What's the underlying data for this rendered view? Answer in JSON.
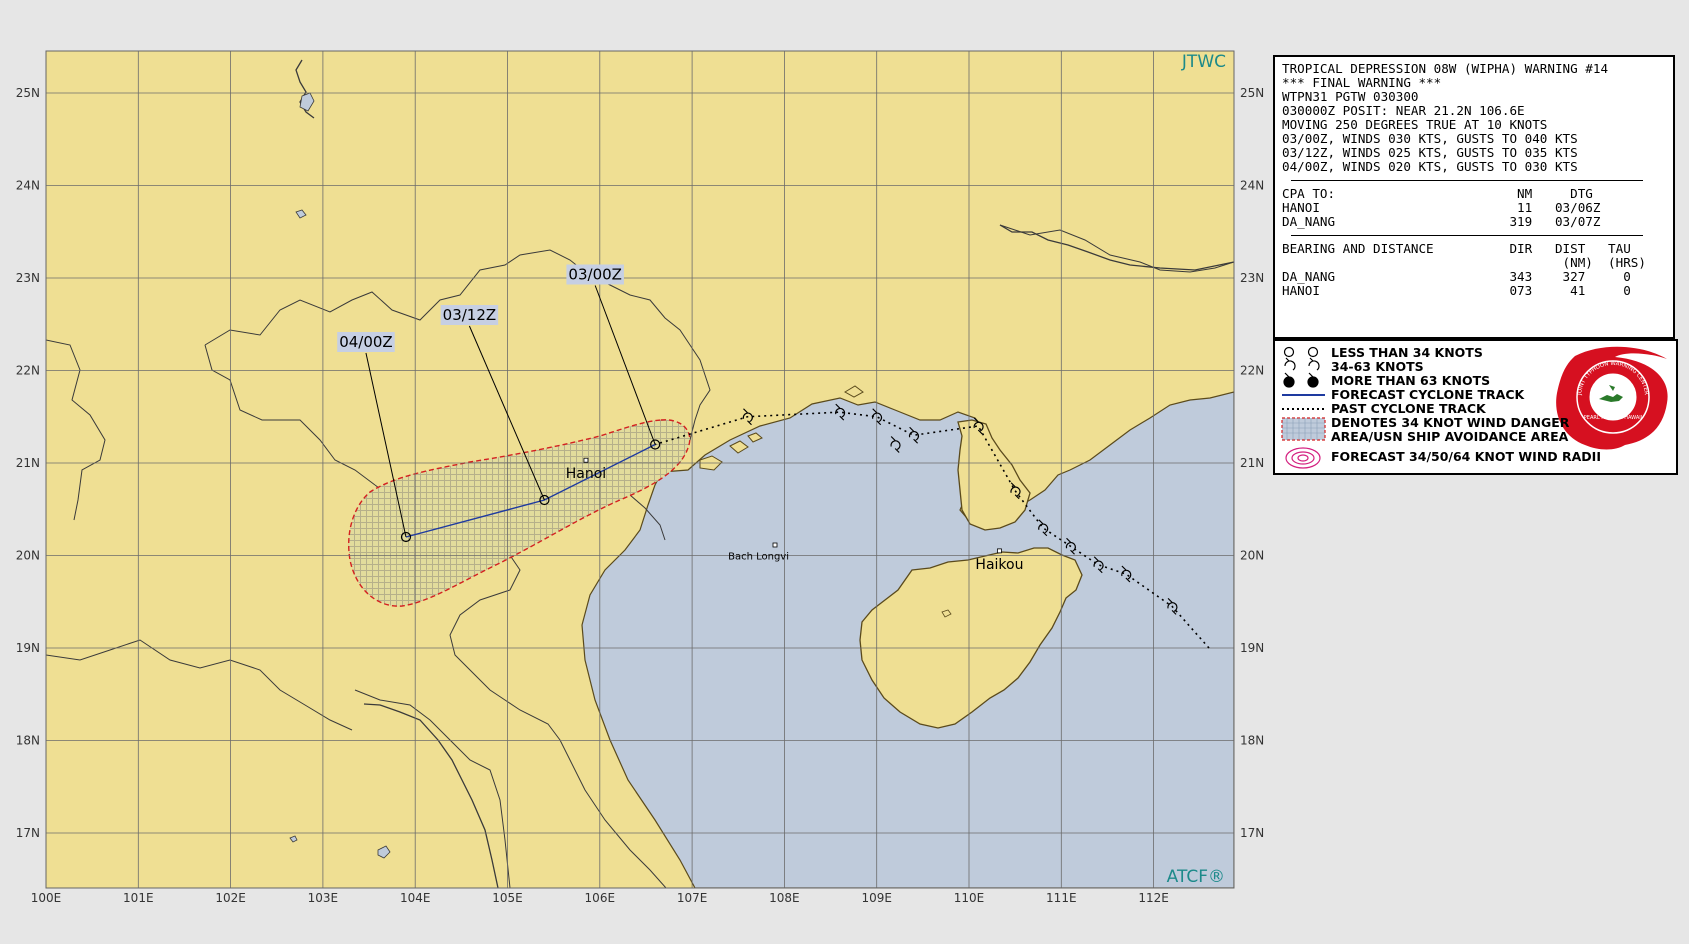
{
  "map": {
    "agency_label": "JTWC",
    "system_label": "ATCF®",
    "colors": {
      "land": "#efdf93",
      "sea": "#bfcbdb",
      "background": "#e6e6e6",
      "grid": "#6b6b6b",
      "track": "#1e3aa0",
      "danger_area": "#d0d0d0",
      "danger_edge": "#d42020"
    },
    "lon_labels": [
      "100E",
      "101E",
      "102E",
      "103E",
      "104E",
      "105E",
      "106E",
      "107E",
      "108E",
      "109E",
      "110E",
      "111E",
      "112E"
    ],
    "lat_labels": [
      "25N",
      "24N",
      "23N",
      "22N",
      "21N",
      "20N",
      "19N",
      "18N",
      "17N"
    ],
    "cities": [
      {
        "name": "Hanoi",
        "lon": 105.85,
        "lat": 21.03
      },
      {
        "name": "Bach Longvi",
        "lon": 107.72,
        "lat": 20.13
      },
      {
        "name": "Haikou",
        "lon": 110.33,
        "lat": 20.05
      }
    ],
    "forecast_points": [
      {
        "label": "03/00Z",
        "lon": 106.6,
        "lat": 21.2
      },
      {
        "label": "03/12Z",
        "lon": 105.4,
        "lat": 20.6
      },
      {
        "label": "04/00Z",
        "lon": 103.9,
        "lat": 20.2
      }
    ],
    "past_track": [
      {
        "lon": 112.6,
        "lat": 19.0
      },
      {
        "lon": 112.2,
        "lat": 19.45
      },
      {
        "lon": 111.7,
        "lat": 19.8
      },
      {
        "lon": 111.4,
        "lat": 19.9
      },
      {
        "lon": 111.1,
        "lat": 20.1
      },
      {
        "lon": 110.8,
        "lat": 20.3
      },
      {
        "lon": 110.5,
        "lat": 20.7
      },
      {
        "lon": 110.1,
        "lat": 21.4
      },
      {
        "lon": 109.4,
        "lat": 21.3
      },
      {
        "lon": 109.0,
        "lat": 21.5
      },
      {
        "lon": 108.6,
        "lat": 21.55
      },
      {
        "lon": 107.6,
        "lat": 21.5
      },
      {
        "lon": 106.6,
        "lat": 21.2
      }
    ],
    "past_track_symbols": [
      {
        "lon": 112.2,
        "lat": 19.45
      },
      {
        "lon": 111.4,
        "lat": 19.9
      },
      {
        "lon": 111.7,
        "lat": 19.8
      },
      {
        "lon": 111.1,
        "lat": 20.1
      },
      {
        "lon": 110.8,
        "lat": 20.3
      },
      {
        "lon": 110.5,
        "lat": 20.7
      },
      {
        "lon": 110.1,
        "lat": 21.4
      },
      {
        "lon": 109.4,
        "lat": 21.3
      },
      {
        "lon": 109.2,
        "lat": 21.2
      },
      {
        "lon": 109.0,
        "lat": 21.5
      },
      {
        "lon": 108.6,
        "lat": 21.55
      },
      {
        "lon": 107.6,
        "lat": 21.5
      }
    ]
  },
  "warning": {
    "lines": [
      "TROPICAL DEPRESSION 08W (WIPHA) WARNING #14",
      "*** FINAL WARNING ***",
      "WTPN31 PGTW 030300",
      "030000Z POSIT: NEAR 21.2N 106.6E",
      "MOVING 250 DEGREES TRUE AT 10 KNOTS",
      "03/00Z, WINDS 030 KTS, GUSTS TO 040 KTS",
      "03/12Z, WINDS 025 KTS, GUSTS TO 035 KTS",
      "04/00Z, WINDS 020 KTS, GUSTS TO 030 KTS"
    ],
    "cpa_lines": [
      "CPA TO:                        NM     DTG",
      "HANOI                          11   03/06Z",
      "DA_NANG                       319   03/07Z"
    ],
    "bearing_lines": [
      "BEARING AND DISTANCE          DIR   DIST   TAU",
      "                                     (NM)  (HRS)",
      "DA_NANG                       343    327     0",
      "HANOI                         073     41     0"
    ]
  },
  "legend": {
    "items": [
      "LESS THAN 34 KNOTS",
      "34-63 KNOTS",
      "MORE THAN 63 KNOTS",
      "FORECAST CYCLONE TRACK",
      "PAST CYCLONE TRACK",
      "DENOTES 34 KNOT WIND DANGER",
      "AREA/USN SHIP AVOIDANCE AREA",
      "FORECAST 34/50/64 KNOT WIND RADII"
    ],
    "seal_text": "JOINT TYPHOON WARNING CENTER",
    "seal_subtext": "PEARL HARBOR HAWAII"
  }
}
